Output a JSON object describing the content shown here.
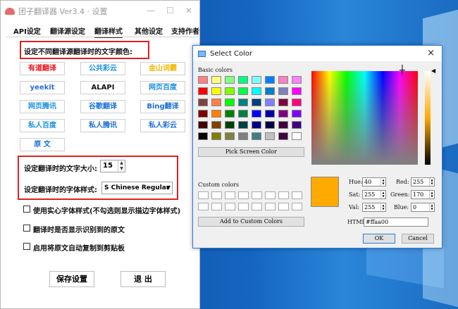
{
  "main": {
    "title": "团子翻译器 Ver3.4 · 设置",
    "tabs": [
      "API设定",
      "翻译源设定",
      "翻译样式",
      "其他设定",
      "支持作者"
    ],
    "color_section_title": "设定不同翻译源翻译时的文字颜色:",
    "color_buttons": [
      {
        "label": "有道翻译",
        "color": "#e8141a"
      },
      {
        "label": "公共彩云",
        "color": "#1a8fe0"
      },
      {
        "label": "金山词霸",
        "color": "#f0b800"
      },
      {
        "label": "yeekit",
        "color": "#2b6ed6"
      },
      {
        "label": "ALAPI",
        "color": "#111111"
      },
      {
        "label": "网页百度",
        "color": "#1a8fe0"
      },
      {
        "label": "网页腾讯",
        "color": "#1a8fe0"
      },
      {
        "label": "谷歌翻译",
        "color": "#1a6ed6"
      },
      {
        "label": "Bing翻译",
        "color": "#1a6ed6"
      },
      {
        "label": "私人百度",
        "color": "#1a8fe0"
      },
      {
        "label": "私人腾讯",
        "color": "#1a6ed6"
      },
      {
        "label": "私人彩云",
        "color": "#1a6ed6"
      },
      {
        "label": "原 文",
        "color": "#1a6ed6"
      }
    ],
    "font_size_label": "设定翻译时的文字大小:",
    "font_size_value": "15",
    "font_style_label": "设定翻译时的字体样式:",
    "font_style_value": "S Chinese Regular",
    "checkboxes": [
      "使用实心字体样式(不勾选则显示描边字体样式)",
      "翻译时是否显示识别到的原文",
      "启用将原文自动复制到剪贴板"
    ],
    "save_label": "保存设置",
    "exit_label": "退 出"
  },
  "dialog": {
    "title": "Select Color",
    "close_icon": "×",
    "basic_colors_label": "Basic colors",
    "basic_colors": [
      [
        "#ff8080",
        "#ffff80",
        "#80ff80",
        "#00ff80",
        "#80ffff",
        "#0080ff",
        "#ff80c0",
        "#ff80ff"
      ],
      [
        "#ff0000",
        "#ffff00",
        "#80ff00",
        "#00ff40",
        "#00ffff",
        "#0080c0",
        "#8080c0",
        "#ff00ff"
      ],
      [
        "#804040",
        "#ff8040",
        "#00ff00",
        "#008080",
        "#004080",
        "#8080ff",
        "#800040",
        "#ff0080"
      ],
      [
        "#800000",
        "#ff8000",
        "#008000",
        "#008040",
        "#0000ff",
        "#0000a0",
        "#800080",
        "#8000ff"
      ],
      [
        "#400000",
        "#804000",
        "#004000",
        "#004040",
        "#000080",
        "#000040",
        "#400040",
        "#400080"
      ],
      [
        "#000000",
        "#808000",
        "#808040",
        "#808080",
        "#408080",
        "#c0c0c0",
        "#400040",
        "#ffffff"
      ]
    ],
    "pick_screen_label": "Pick Screen Color",
    "custom_colors_label": "Custom colors",
    "add_custom_label": "Add to Custom Colors",
    "current_color": "#ffaa00",
    "hue_label": "Hue:",
    "hue": "40",
    "sat_label": "Sat:",
    "sat": "255",
    "val_label": "Val:",
    "val": "255",
    "red_label": "Red:",
    "red": "255",
    "green_label": "Green:",
    "green": "170",
    "blue_label": "Blue:",
    "blue": "0",
    "html_label": "HTML:",
    "html": "#ffaa00",
    "ok_label": "OK",
    "cancel_label": "Cancel"
  }
}
